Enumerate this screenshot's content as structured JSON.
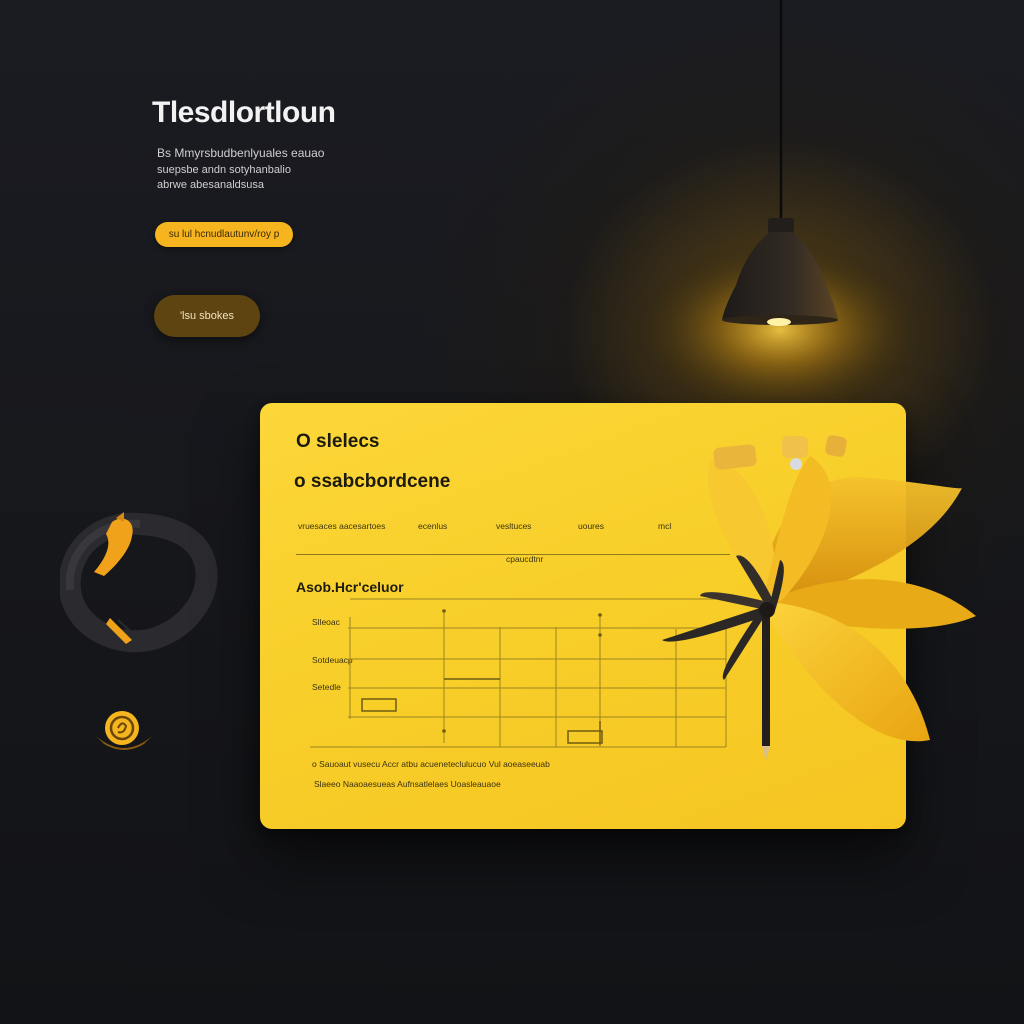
{
  "hero": {
    "title": "Tlesdlortloun",
    "subtitle_lines": [
      "Bs Mmyrsbudbenlyuales eauao",
      "suepsbe andn sotyhanbalio",
      "abrwe abesanaldsusa"
    ]
  },
  "actions": {
    "primary_label": "su lul hcnudlautunv/roy p",
    "secondary_label": "'lsu sbokes"
  },
  "card": {
    "title_small": "O slelecs",
    "title_large": "o ssabcbordcene",
    "columns": [
      "vruesaces aacesartoes",
      "ecenlus",
      "vesltuces",
      "uoures",
      "mcl"
    ],
    "sub_note": "cpaucdtnr",
    "section_title": "Asob.Hcr'celuor",
    "rows": [
      "Slleoac",
      "Sotdeuacp",
      "Setedle"
    ],
    "footer_lines": [
      "o  Sauoaut vusecu Accr atbu acueneteclulucuo Vul aoeaseeuab",
      "Slaeeo  Naaoaesueas Aufnsatlelaes Uoasleauaoe"
    ]
  },
  "colors": {
    "background": "#16171b",
    "card": "#f8cf2a",
    "accent": "#f6b51e",
    "secondary_button": "#5e4411",
    "lamp_shade": "#2a2522"
  },
  "icons": {
    "lamp": "pendant-lamp-icon",
    "flower": "paper-flower-illustration",
    "bird": "bird-ring-illustration",
    "coin": "gold-coin-icon"
  }
}
